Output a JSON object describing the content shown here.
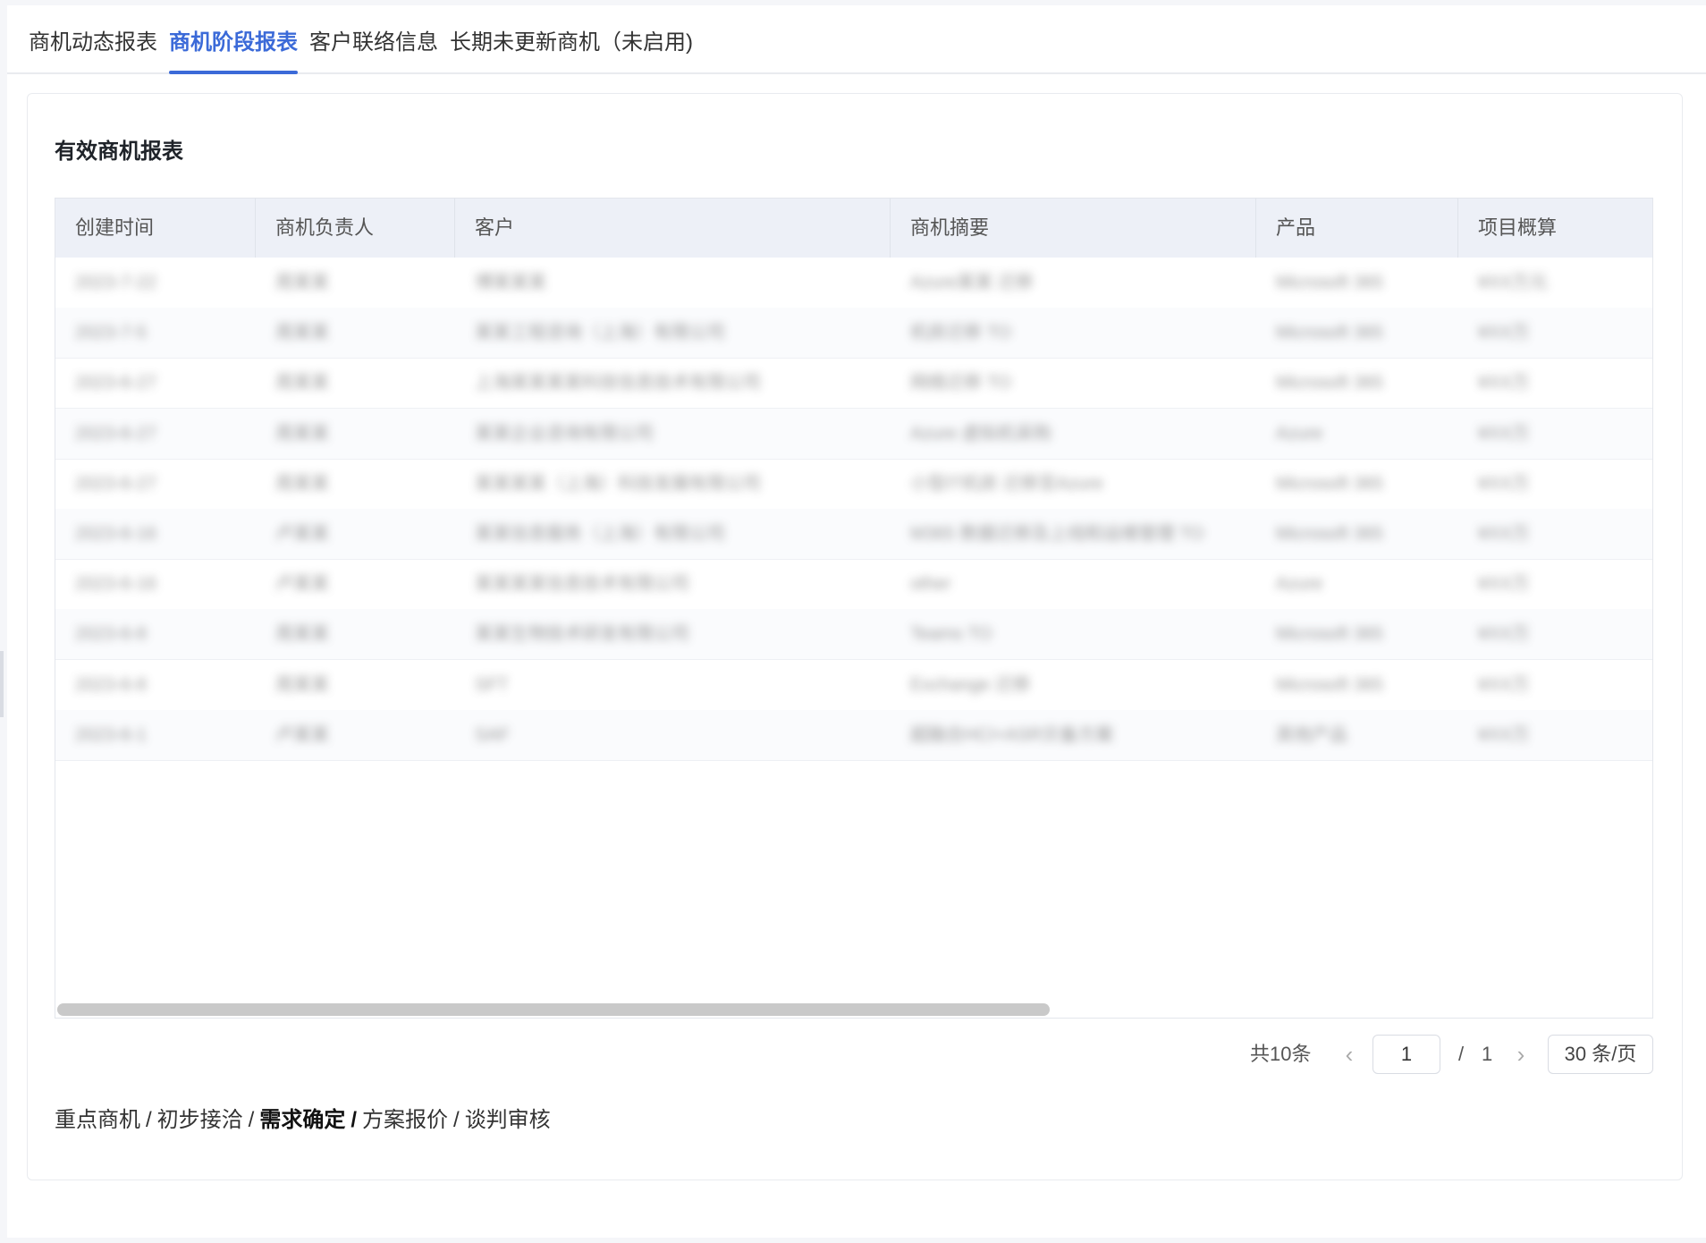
{
  "tabs": [
    {
      "label": "商机动态报表",
      "active": false
    },
    {
      "label": "商机阶段报表",
      "active": true
    },
    {
      "label": "客户联络信息",
      "active": false
    },
    {
      "label": "长期未更新商机（未启用)",
      "active": false
    }
  ],
  "card": {
    "title": "有效商机报表"
  },
  "table": {
    "columns": [
      "创建时间",
      "商机负责人",
      "客户",
      "商机摘要",
      "产品",
      "项目概算"
    ],
    "rows": [
      [
        "2023-7-22",
        "周某某",
        "博某某某",
        "Azure某某 迁移",
        "Microsoft 365",
        "¥XX万元"
      ],
      [
        "2023-7-5",
        "周某某",
        "某某工程咨询（上海）有限公司",
        "机房迁移 TO",
        "Microsoft 365",
        "¥XX万"
      ],
      [
        "2023-6-27",
        "周某某",
        "上海某某某某科技信息技术有限公司",
        "网络迁移 TO",
        "Microsoft 365",
        "¥XX万"
      ],
      [
        "2023-6-27",
        "周某某",
        "某某企业咨询有限公司",
        "Azure 虚拟机采购",
        "Azure",
        "¥XX万"
      ],
      [
        "2023-6-27",
        "周某某",
        "某某某某（上海）科技发展有限公司",
        "小型IT机房 迁移至Azure",
        "Microsoft 365",
        "¥XX万"
      ],
      [
        "2023-6-16",
        "卢某某",
        "某某信息服务（上海）有限公司",
        "M365 数据迁移及上线和运维管理 TO",
        "Microsoft 365",
        "¥XX万"
      ],
      [
        "2023-6-16",
        "卢某某",
        "某某某某信息技术有限公司",
        "other",
        "Azure",
        "¥XX万"
      ],
      [
        "2023-6-8",
        "周某某",
        "某某生物技术研发有限公司",
        "Teams TO",
        "Microsoft 365",
        "¥XX万"
      ],
      [
        "2023-6-8",
        "周某某",
        "SFT",
        "Exchange 迁移",
        "Microsoft 365",
        "¥XX万"
      ],
      [
        "2023-6-1",
        "卢某某",
        "SAF",
        "超融合HCI+ASR灾备方案",
        "其他产品",
        "¥XX万"
      ]
    ]
  },
  "pagination": {
    "total": "共10条",
    "prev_icon": "chevron-left-icon",
    "next_icon": "chevron-right-icon",
    "current_page": "1",
    "separator": "/",
    "total_pages": "1",
    "page_size": "30 条/页"
  },
  "stages": [
    {
      "label": "重点商机",
      "current": false
    },
    {
      "label": "初步接洽",
      "current": false
    },
    {
      "label": "需求确定",
      "current": true
    },
    {
      "label": "方案报价",
      "current": false
    },
    {
      "label": "谈判审核",
      "current": false
    }
  ],
  "colors": {
    "accent": "#3b6ad8",
    "header_bg": "#edf0f7",
    "border": "#e9ebef"
  }
}
